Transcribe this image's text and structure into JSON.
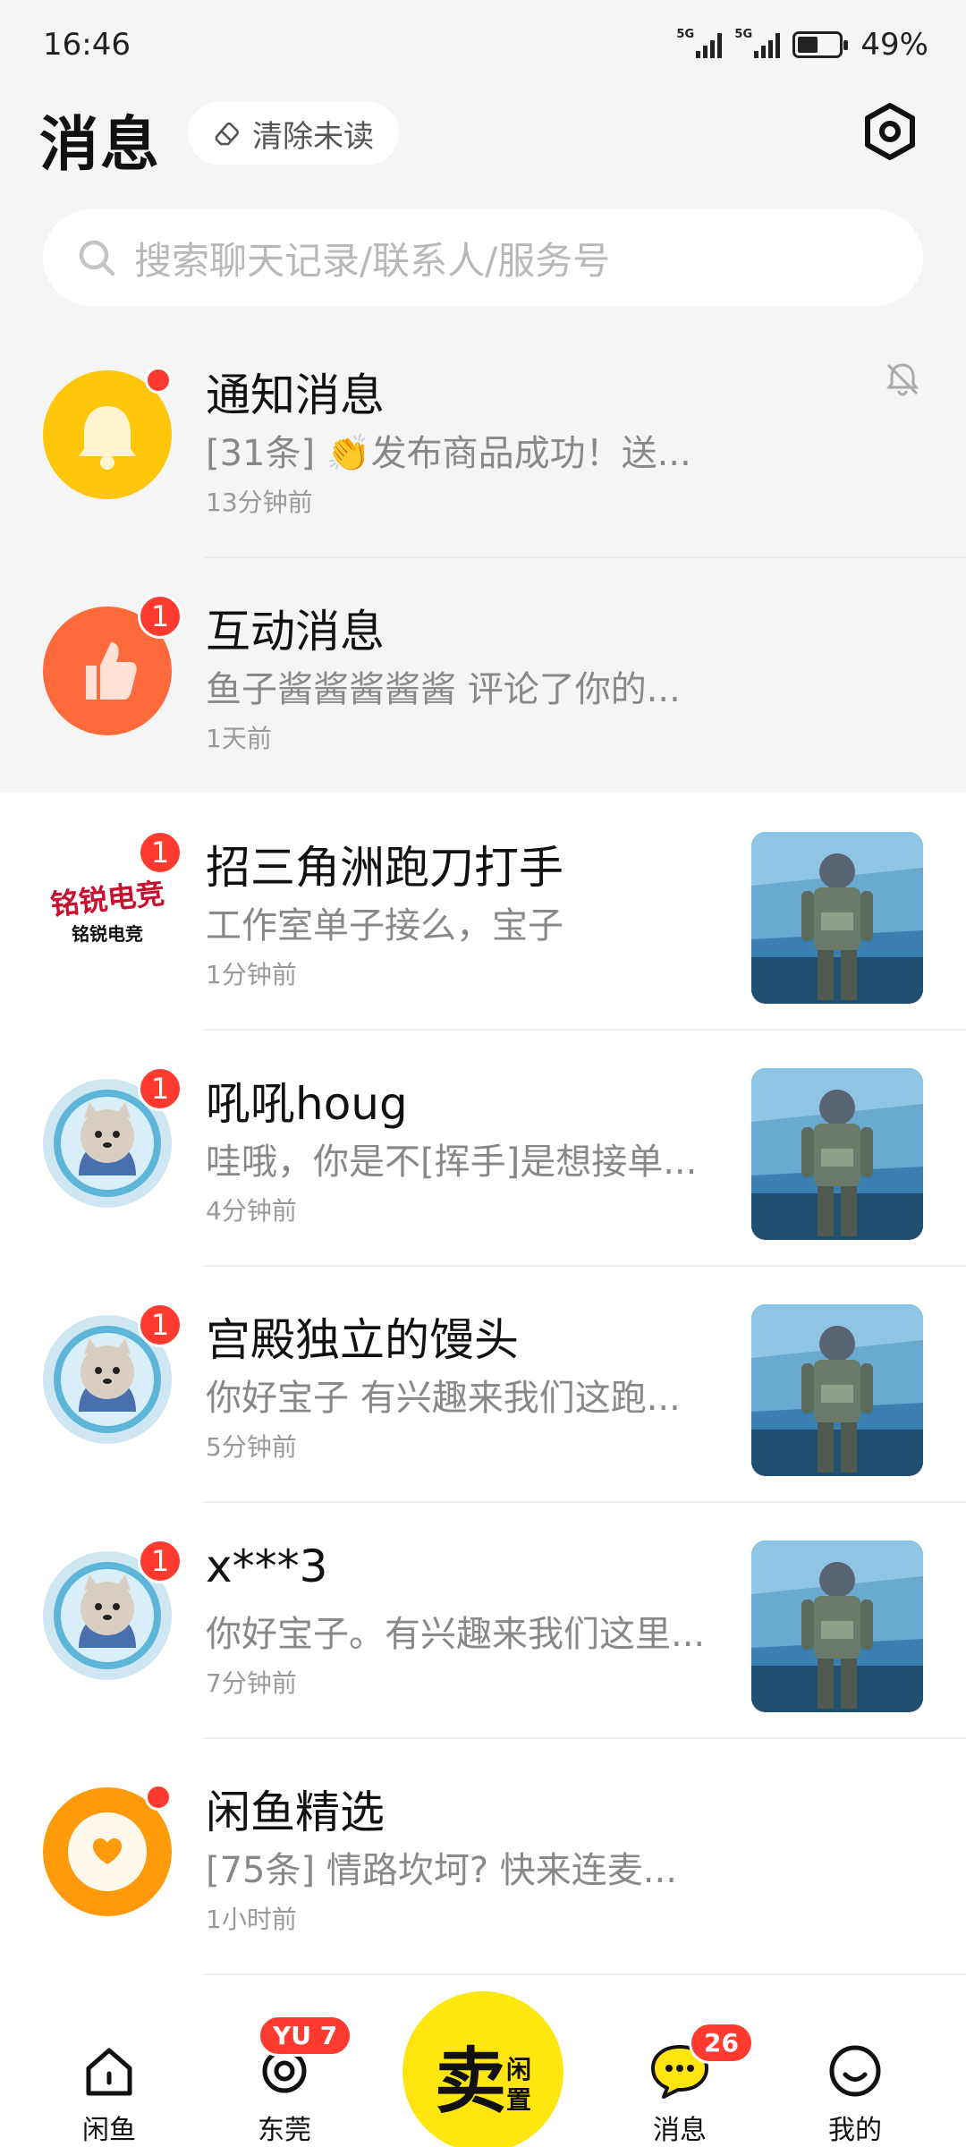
{
  "status": {
    "time": "16:46",
    "net1": "5G",
    "net2": "5G",
    "battery": "49%"
  },
  "header": {
    "title": "消息",
    "clear_label": "清除未读"
  },
  "search": {
    "placeholder": "搜索聊天记录/联系人/服务号"
  },
  "conversations": [
    {
      "title": "通知消息",
      "message": "[31条] 👏发布商品成功！送...",
      "time": "13分钟前",
      "badge": "",
      "muted": true
    },
    {
      "title": "互动消息",
      "message": "鱼子酱酱酱酱酱 评论了你的...",
      "time": "1天前",
      "badge": "1"
    },
    {
      "title": "招三角洲跑刀打手",
      "message": "工作室单子接么，宝子",
      "time": "1分钟前",
      "badge": "1",
      "avatar_text_1": "铭锐电竞",
      "avatar_text_2": "铭锐电竞"
    },
    {
      "title": "吼吼houg",
      "message": "哇哦，你是不[挥手]是想接单...",
      "time": "4分钟前",
      "badge": "1"
    },
    {
      "title": "宫殿独立的馒头",
      "message": "你好宝子  有兴趣来我们这跑...",
      "time": "5分钟前",
      "badge": "1"
    },
    {
      "title": "x***3",
      "message": "你好宝子。有兴趣来我们这里...",
      "time": "7分钟前",
      "badge": "1"
    },
    {
      "title": "闲鱼精选",
      "message": "[75条] 情路坎坷? 快来连麦...",
      "time": "1小时前",
      "badge": ""
    }
  ],
  "bottom_nav": {
    "home": "闲鱼",
    "city": "东莞",
    "city_badge": "YU 7",
    "sell_big": "卖",
    "sell_small_1": "闲",
    "sell_small_2": "置",
    "messages": "消息",
    "messages_badge": "26",
    "me": "我的"
  },
  "colors": {
    "accent": "#ffe60f",
    "badge": "#ff3b30",
    "notify": "#ffc60a",
    "interact": "#ff6a3d",
    "featured": "#ff9a0a"
  }
}
